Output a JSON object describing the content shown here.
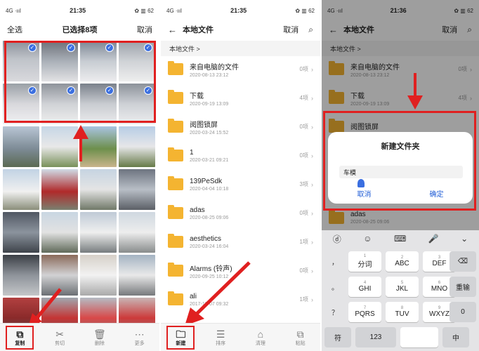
{
  "panel1": {
    "status": {
      "left": "4G ·ııl",
      "time": "21:35",
      "right": "✿ ▥ 62"
    },
    "title": {
      "select_all": "全选",
      "selected": "已选择8项",
      "cancel": "取消"
    },
    "bottom_actions": [
      {
        "label": "复制",
        "icon": "copy-icon"
      },
      {
        "label": "剪切",
        "icon": "scissors-icon"
      },
      {
        "label": "删除",
        "icon": "trash-icon"
      },
      {
        "label": "更多",
        "icon": "more-icon"
      }
    ]
  },
  "panel2": {
    "status": {
      "left": "4G ·ııl",
      "time": "21:35",
      "right": "✿ ▥ 62"
    },
    "title": {
      "name": "本地文件",
      "cancel": "取消"
    },
    "breadcrumb": "本地文件 >",
    "folders": [
      {
        "name": "来自电脑的文件",
        "date": "2020-08-13 23:12",
        "count": "0项"
      },
      {
        "name": "下载",
        "date": "2020-09-19 13:09",
        "count": "4项"
      },
      {
        "name": "阅图锁屏",
        "date": "2020-03-24 15:52",
        "count": "0项"
      },
      {
        "name": "1",
        "date": "2020-03-21 09:21",
        "count": "0项"
      },
      {
        "name": "139PeSdk",
        "date": "2020-04-04 10:18",
        "count": "3项"
      },
      {
        "name": "adas",
        "date": "2020-08-25 09:06",
        "count": "0项"
      },
      {
        "name": "aesthetics",
        "date": "2020-03-24 16:04",
        "count": "1项"
      },
      {
        "name": "Alarms (铃声)",
        "date": "2020-09-25 10:12",
        "count": "0项"
      },
      {
        "name": "ali",
        "date": "2017-10-07 09:32",
        "count": "1项"
      }
    ],
    "bottom_actions": [
      {
        "label": "新建",
        "icon": "new-folder-icon"
      },
      {
        "label": "排序",
        "icon": "sort-icon"
      },
      {
        "label": "清理",
        "icon": "clean-icon"
      },
      {
        "label": "粘贴",
        "icon": "paste-icon"
      }
    ]
  },
  "panel3": {
    "status": {
      "left": "4G ·ııl",
      "time": "21:36",
      "right": "✿ ▥ 62"
    },
    "title": {
      "name": "本地文件",
      "cancel": "取消"
    },
    "breadcrumb": "本地文件 >",
    "folders": [
      {
        "name": "来自电脑的文件",
        "date": "2020-08-13 23:12",
        "count": "0项"
      },
      {
        "name": "下载",
        "date": "2020-09-19 13:09",
        "count": "4项"
      },
      {
        "name": "阅图锁屏",
        "date": "",
        "count": ""
      }
    ],
    "last_folder": {
      "name": "adas",
      "date": "2020-08-25 09:06"
    },
    "dialog": {
      "title": "新建文件夹",
      "input_value": "车模",
      "cancel": "取消",
      "confirm": "确定"
    },
    "keyboard": {
      "top": [
        "ⓓ",
        "☺",
        "⌨",
        "🎤",
        "⌄"
      ],
      "row1": [
        {
          "main": "分词",
          "sub": "1"
        },
        {
          "main": "ABC",
          "sub": "2"
        },
        {
          "main": "DEF",
          "sub": "3"
        }
      ],
      "row2": [
        {
          "main": "GHI",
          "sub": "4"
        },
        {
          "main": "JKL",
          "sub": "5"
        },
        {
          "main": "MNO",
          "sub": "6"
        }
      ],
      "row3": [
        {
          "main": "PQRS",
          "sub": "7"
        },
        {
          "main": "TUV",
          "sub": "8"
        },
        {
          "main": "WXYZ",
          "sub": "9"
        }
      ],
      "left_col": [
        "，",
        "。",
        "？",
        "！"
      ],
      "right_col": [
        "⌫",
        "重输",
        "0"
      ],
      "bottom": [
        "符",
        "123",
        "中"
      ]
    }
  }
}
